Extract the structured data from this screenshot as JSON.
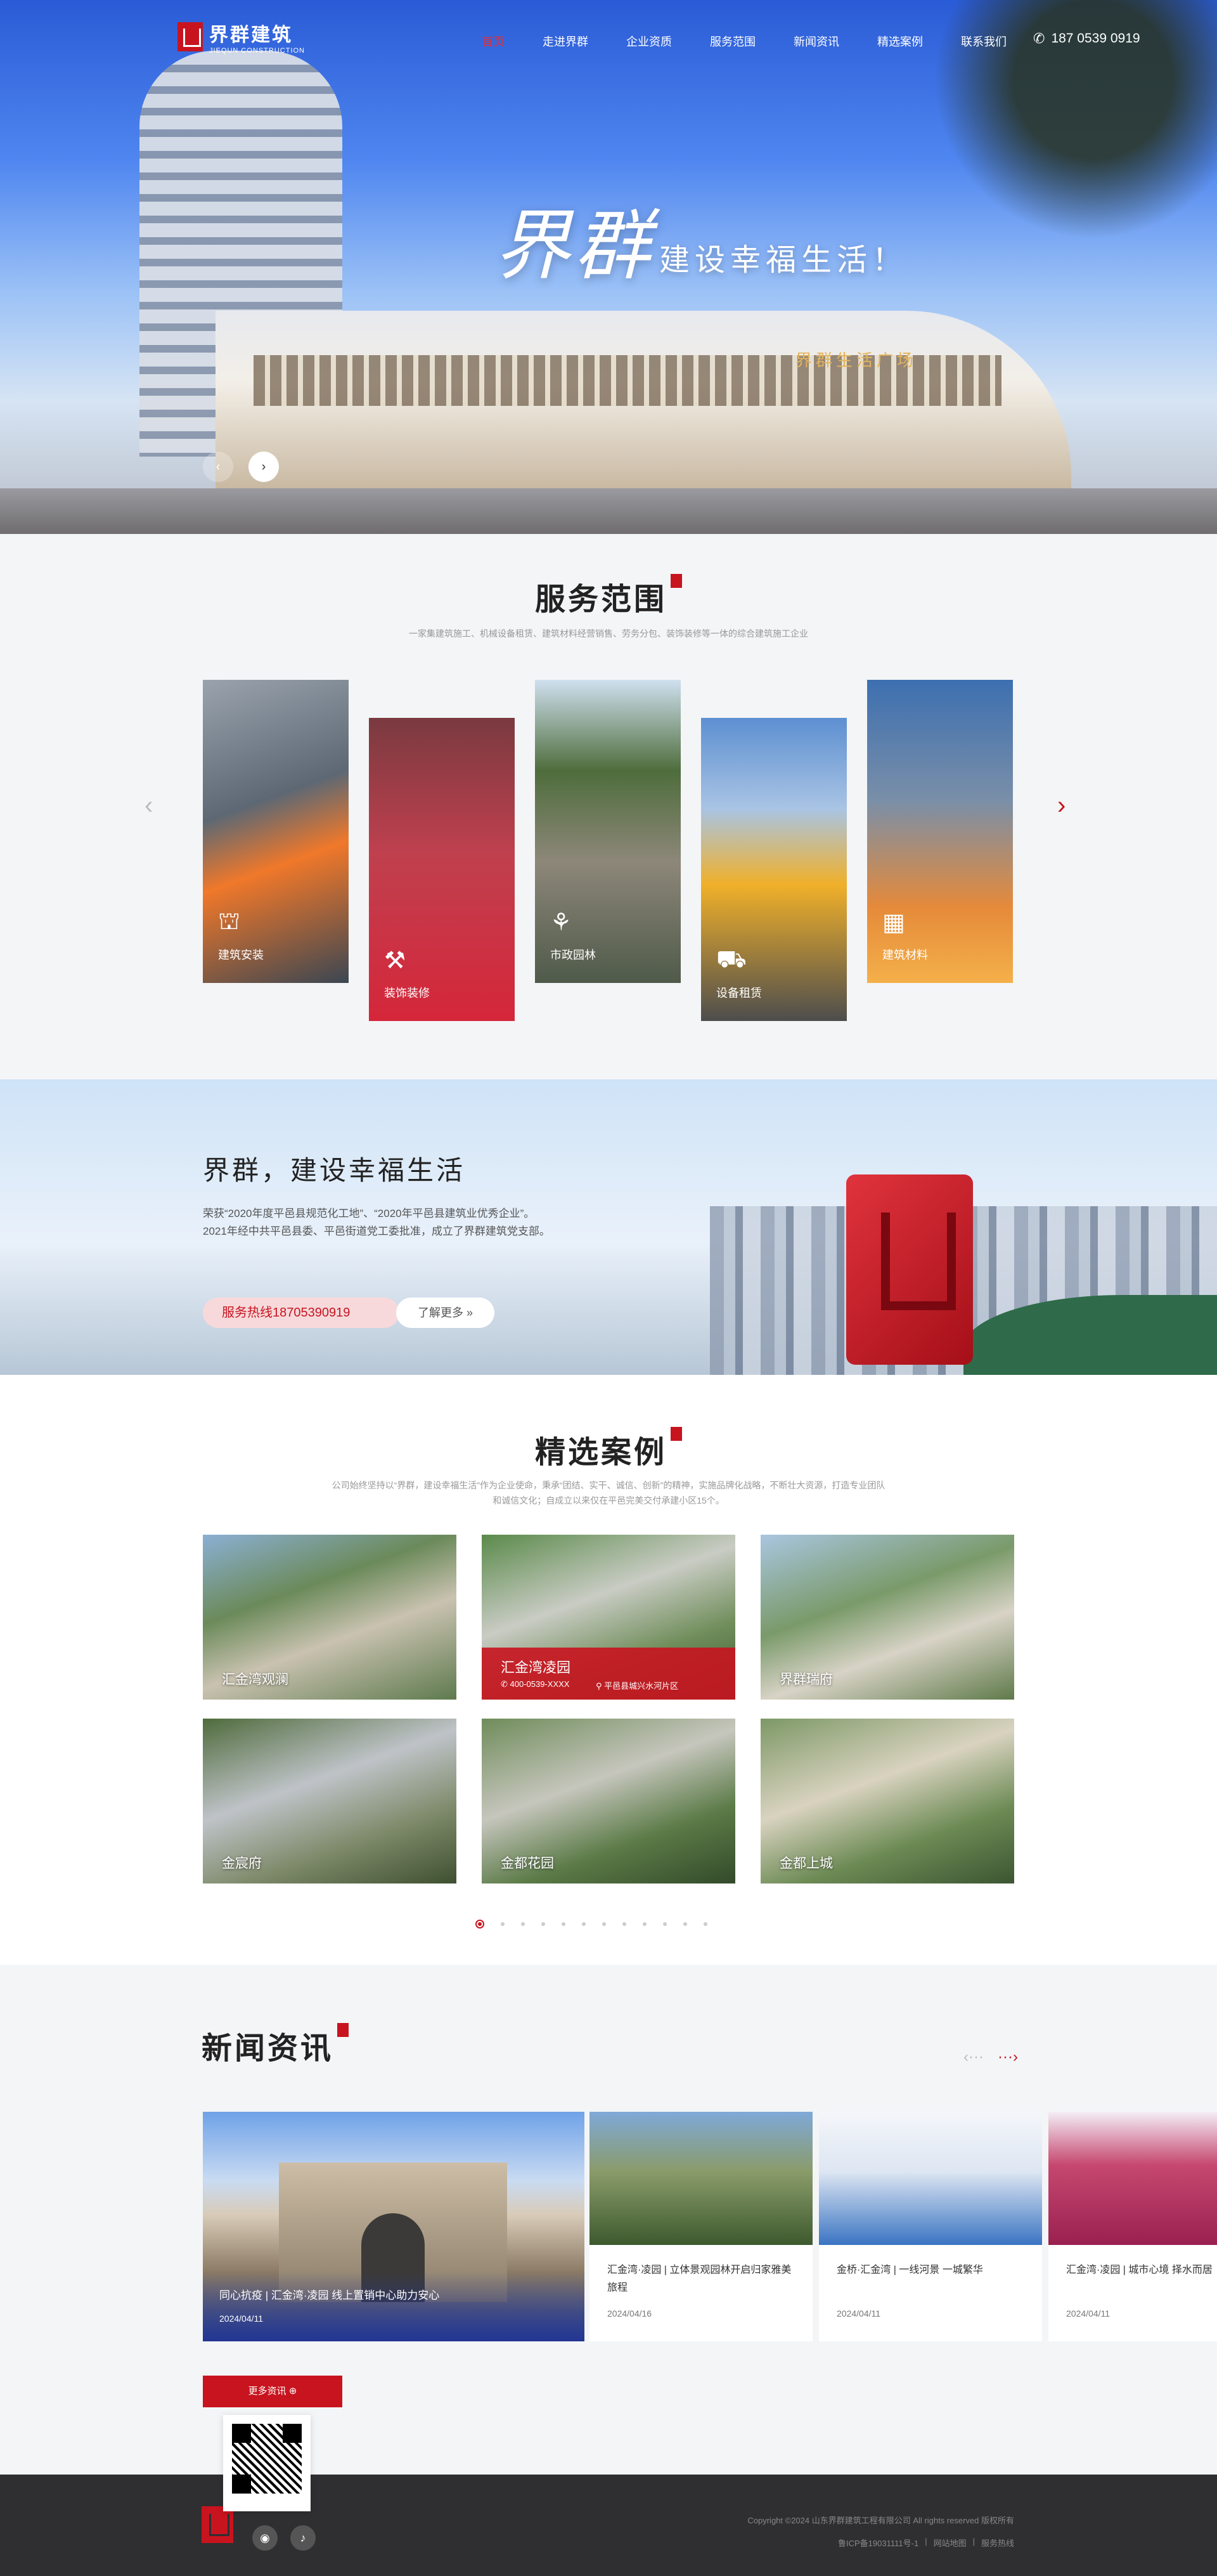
{
  "brand": {
    "cn": "界群建筑",
    "en": "JIEQUN CONSTRUCTION"
  },
  "nav": [
    {
      "label": "首页",
      "active": true
    },
    {
      "label": "走进界群",
      "active": false
    },
    {
      "label": "企业资质",
      "active": false
    },
    {
      "label": "服务范围",
      "active": false
    },
    {
      "label": "新闻资讯",
      "active": false
    },
    {
      "label": "精选案例",
      "active": false
    },
    {
      "label": "联系我们",
      "active": false
    }
  ],
  "phone": "187 0539 0919",
  "hero": {
    "slogan_big": "界群",
    "slogan_small": "建设幸福生活！",
    "sign": "界群生活广场"
  },
  "services": {
    "title": "服务范围",
    "subtitle": "一家集建筑施工、机械设备租赁、建筑材料经营销售、劳务分包、装饰装修等一体的综合建筑施工企业",
    "items": [
      {
        "label": "建筑安装",
        "icon": "crane-icon"
      },
      {
        "label": "装饰装修",
        "icon": "paint-roller-icon"
      },
      {
        "label": "市政园林",
        "icon": "tree-icon"
      },
      {
        "label": "设备租赁",
        "icon": "excavator-icon"
      },
      {
        "label": "建筑材料",
        "icon": "material-icon"
      }
    ]
  },
  "banner": {
    "title": "界群，建设幸福生活",
    "desc_1": "荣获“2020年度平邑县规范化工地”、“2020年平邑县建筑业优秀企业”。",
    "desc_2": "2021年经中共平邑县委、平邑街道党工委批准，成立了界群建筑党支部。",
    "hotline": "服务热线18705390919",
    "more": "了解更多 »"
  },
  "cases": {
    "title": "精选案例",
    "subtitle_1": "公司始终坚持以“界群，建设幸福生活”作为企业使命，秉承“团结、实干、诚信、创新”的精神，实施品牌化战略，不断壮大资源，打造专业团队",
    "subtitle_2": "和诚信文化；自成立以来仅在平邑完美交付承建小区15个。",
    "items": [
      {
        "name": "汇金湾观澜"
      },
      {
        "name": "汇金湾凌园",
        "phone": "400-0539-XXXX",
        "address": "平邑县城兴水河片区"
      },
      {
        "name": "界群瑞府"
      },
      {
        "name": "金宸府"
      },
      {
        "name": "金都花园"
      },
      {
        "name": "金都上城"
      }
    ],
    "page_count": 12,
    "current_page": 1
  },
  "news": {
    "title": "新闻资讯",
    "featured": {
      "title": "同心抗疫 | 汇金湾·凌园 线上置销中心助力安心",
      "date": "2024/04/11"
    },
    "items": [
      {
        "title": "汇金湾·凌园 | 立体景观园林开启归家雅美旅程",
        "date": "2024/04/16"
      },
      {
        "title": "金桥·汇金湾 | 一线河景 一城繁华",
        "date": "2024/04/11"
      },
      {
        "title": "汇金湾·凌园 | 城市心境 择水而居",
        "date": "2024/04/11"
      }
    ],
    "more": "更多资讯 ⊕"
  },
  "footer": {
    "copyright": "Copyright ©2024 山东界群建筑工程有限公司 All rights reserved 版权所有",
    "icp": "鲁ICP备19031111号-1",
    "sitemap": "网站地图",
    "admin": "服务热线"
  },
  "colors": {
    "brand_red": "#c8141f",
    "footer_bg": "#2f2f31",
    "section_bg": "#f4f5f7"
  }
}
